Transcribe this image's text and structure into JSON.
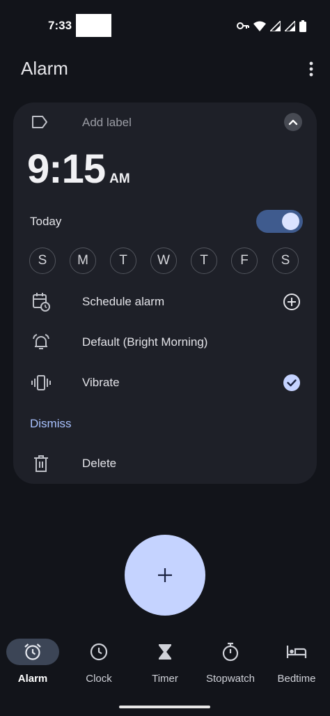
{
  "status_bar": {
    "time": "7:33",
    "icons": [
      "vpn-key-icon",
      "wifi-icon",
      "signal-icon",
      "signal-icon",
      "battery-icon"
    ]
  },
  "app_bar": {
    "title": "Alarm",
    "menu_icon": "more-vert-icon"
  },
  "alarm": {
    "label_placeholder": "Add label",
    "time": "9:15",
    "ampm": "AM",
    "schedule_text": "Today",
    "enabled": true,
    "days": [
      "S",
      "M",
      "T",
      "W",
      "T",
      "F",
      "S"
    ],
    "schedule_alarm_label": "Schedule alarm",
    "sound_label": "Default (Bright Morning)",
    "vibrate_label": "Vibrate",
    "vibrate_checked": true,
    "dismiss_label": "Dismiss",
    "delete_label": "Delete"
  },
  "fab": {
    "icon": "plus-icon"
  },
  "bottom_nav": {
    "items": [
      {
        "label": "Alarm",
        "icon": "alarm-icon",
        "active": true
      },
      {
        "label": "Clock",
        "icon": "clock-icon",
        "active": false
      },
      {
        "label": "Timer",
        "icon": "hourglass-icon",
        "active": false
      },
      {
        "label": "Stopwatch",
        "icon": "stopwatch-icon",
        "active": false
      },
      {
        "label": "Bedtime",
        "icon": "bed-icon",
        "active": false
      }
    ]
  },
  "colors": {
    "background": "#12141a",
    "card": "#1e2028",
    "accent": "#a9c2ff",
    "toggle_track": "#3f5b8e",
    "fab": "#c5d3ff"
  }
}
